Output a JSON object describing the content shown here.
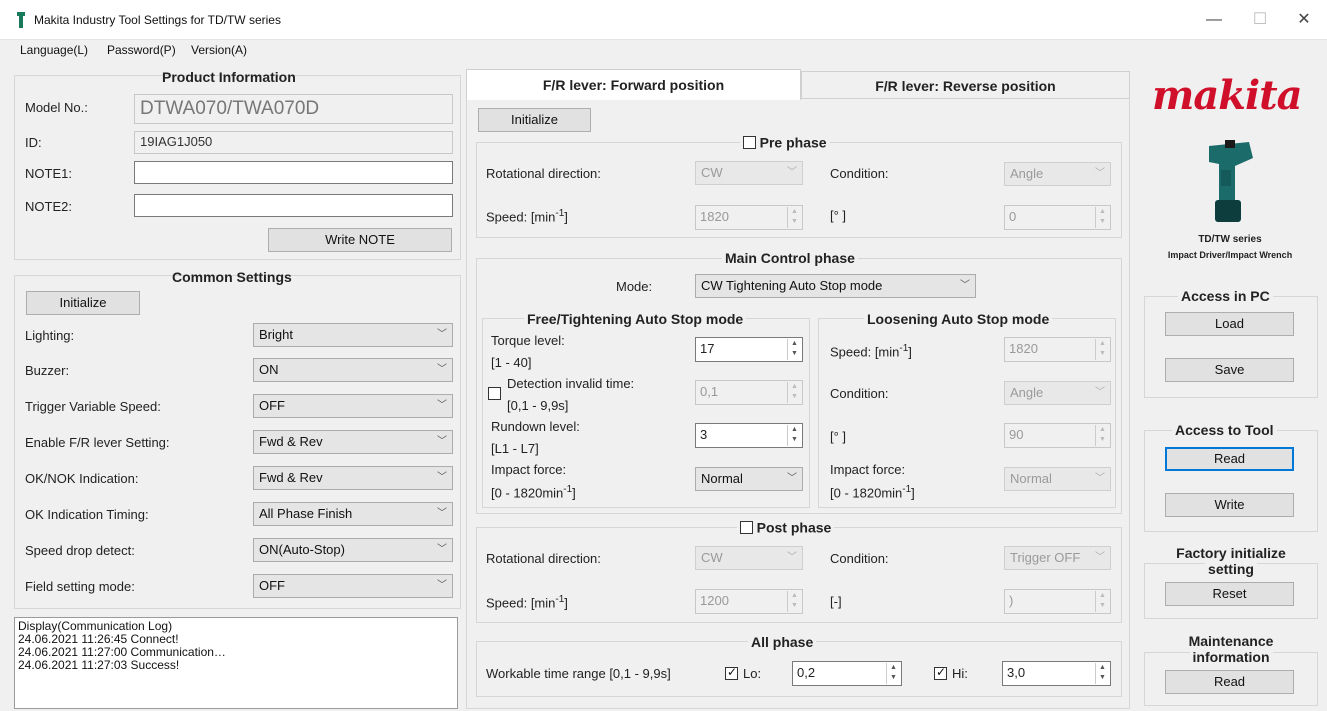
{
  "window": {
    "title": "Makita Industry Tool Settings for TD/TW series"
  },
  "menu": {
    "language": "Language(L)",
    "password": "Password(P)",
    "version": "Version(A)"
  },
  "product": {
    "title": "Product Information",
    "model_label": "Model No.:",
    "model_value": "DTWA070/TWA070D",
    "id_label": "ID:",
    "id_value": "19IAG1J050",
    "note1_label": "NOTE1:",
    "note2_label": "NOTE2:",
    "write_note": "Write NOTE"
  },
  "common": {
    "title": "Common Settings",
    "initialize": "Initialize",
    "rows": [
      {
        "label": "Lighting:",
        "value": "Bright"
      },
      {
        "label": "Buzzer:",
        "value": "ON"
      },
      {
        "label": "Trigger Variable Speed:",
        "value": "OFF"
      },
      {
        "label": "Enable F/R lever Setting:",
        "value": "Fwd & Rev"
      },
      {
        "label": "OK/NOK Indication:",
        "value": "Fwd & Rev"
      },
      {
        "label": "OK Indication Timing:",
        "value": "All Phase Finish"
      },
      {
        "label": "Speed drop detect:",
        "value": "ON(Auto-Stop)"
      },
      {
        "label": "Field setting mode:",
        "value": "OFF"
      }
    ]
  },
  "log": {
    "lines": [
      "Display(Communication Log)",
      "24.06.2021 11:26:45 Connect!",
      "24.06.2021 11:27:00 Communication…",
      "24.06.2021 11:27:03 Success!"
    ]
  },
  "tabs": {
    "forward": "F/R lever: Forward position",
    "reverse": "F/R lever: Reverse position"
  },
  "initialize": "Initialize",
  "pre": {
    "title": "Pre phase",
    "rot_label": "Rotational direction:",
    "rot_value": "CW",
    "cond_label": "Condition:",
    "cond_value": "Angle",
    "speed_label": "Speed: [min",
    "speed_unit_sup": "-1",
    "speed_label_end": "]",
    "speed_value": "1820",
    "deg_label": "[° ]",
    "deg_value": "0"
  },
  "main": {
    "title": "Main Control phase",
    "mode_label": "Mode:",
    "mode_value": "CW Tightening Auto Stop mode",
    "free": {
      "title": "Free/Tightening Auto Stop mode",
      "torque_label1": "Torque level:",
      "torque_label2": "[1 - 40]",
      "torque_value": "17",
      "detect_label1": "Detection invalid time:",
      "detect_label2": "[0,1 - 9,9s]",
      "detect_value": "0,1",
      "rundown_label1": "Rundown level:",
      "rundown_label2": "[L1 - L7]",
      "rundown_value": "3",
      "impact_label1": "Impact force:",
      "impact_label2": "[0 - 1820min",
      "impact_sup": "-1",
      "impact_end": "]",
      "impact_value": "Normal"
    },
    "loosen": {
      "title": "Loosening Auto Stop mode",
      "speed_label": "Speed: [min",
      "speed_sup": "-1",
      "speed_end": "]",
      "speed_value": "1820",
      "cond_label": "Condition:",
      "cond_value": "Angle",
      "deg_label": "[° ]",
      "deg_value": "90",
      "impact_label1": "Impact force:",
      "impact_label2": "[0 - 1820min",
      "impact_sup": "-1",
      "impact_end": "]",
      "impact_value": "Normal"
    }
  },
  "post": {
    "title": "Post phase",
    "rot_label": "Rotational direction:",
    "rot_value": "CW",
    "cond_label": "Condition:",
    "cond_value": "Trigger OFF",
    "speed_label": "Speed: [min",
    "speed_sup": "-1",
    "speed_end": "]",
    "speed_value": "1200",
    "dash_label": "[-]",
    "dash_value": ")"
  },
  "all": {
    "title": "All phase",
    "range_label": "Workable time range [0,1 - 9,9s]",
    "lo_label": "Lo:",
    "lo_value": "0,2",
    "hi_label": "Hi:",
    "hi_value": "3,0"
  },
  "brand": {
    "logo": "makita",
    "series": "TD/TW series",
    "desc": "Impact Driver/Impact Wrench",
    "color": "#d0102a"
  },
  "pc": {
    "title": "Access in PC",
    "load": "Load",
    "save": "Save"
  },
  "tool": {
    "title": "Access to Tool",
    "read": "Read",
    "write": "Write"
  },
  "factory": {
    "title1": "Factory initialize",
    "title2": "setting",
    "reset": "Reset"
  },
  "maint": {
    "title1": "Maintenance",
    "title2": "information",
    "read": "Read"
  },
  "window_controls": {
    "minimize": "—",
    "maximize": "☐",
    "close": "✕"
  }
}
